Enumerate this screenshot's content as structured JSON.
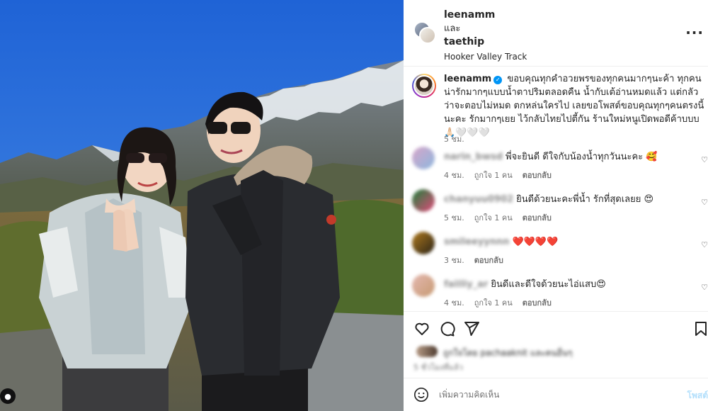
{
  "header": {
    "user1": "leenamm",
    "and_text": "และ",
    "user2": "taethip",
    "location": "Hooker Valley Track",
    "more_icon": "more-horizontal-icon"
  },
  "caption": {
    "username": "leenamm",
    "text": "ขอบคุณทุกคำอวยพรของทุกคนมากๆนะค้า ทุกคนน่ารักมากๆแบบน้ำตาปริมตลอดคืน น้ำกับเต้อ่านหมดแล้ว แต่กลัวว่าจะตอบไม่หมด ตกหล่นใครไป เลยขอโพสต์ขอบคุณทุกๆคนตรงนี้นะคะ รักมากๆเยย ไว้กลับไทยไปตี้กัน ร้านใหม่หนูเปิดพอดีค้าบบบ 🙏🏻🤍🤍🤍",
    "time": "5 ชม."
  },
  "comments": [
    {
      "user": "narin_bwsd",
      "text": "พี่จะยินดี ดีใจกับน้องน้ำทุกวันนะคะ 🥰",
      "time": "4 ชม.",
      "likes": "ถูกใจ 1 คน",
      "reply": "ตอบกลับ"
    },
    {
      "user": "chanyuu0902",
      "text": "ยินดีด้วยนะคะพี่น้ำ รักที่สุดเลยย 😍",
      "time": "5 ชม.",
      "likes": "ถูกใจ 1 คน",
      "reply": "ตอบกลับ"
    },
    {
      "user": "smileeyynnn",
      "text": "❤️❤️❤️❤️",
      "time": "3 ชม.",
      "likes": "",
      "reply": "ตอบกลับ"
    },
    {
      "user": "faiiliy_ar",
      "text": "ยินดีและดีใจด้วยนะไอ่แสบ😍",
      "time": "4 ชม.",
      "likes": "ถูกใจ 1 คน",
      "reply": "ตอบกลับ"
    }
  ],
  "actions": {
    "like_icon": "heart-icon",
    "comment_icon": "comment-icon",
    "share_icon": "share-icon",
    "save_icon": "bookmark-icon"
  },
  "likes_line": "ถูกใจโดย pachaaknit และคนอื่นๆ",
  "post_date": "5 ชั่วโมงที่แล้ว",
  "add_comment": {
    "placeholder": "เพิ่มความคิดเห็น",
    "post_label": "โพสต์",
    "emoji_icon": "emoji-icon"
  },
  "colors": {
    "link_blue": "#0095f6",
    "post_disabled": "#b2dffc",
    "heart_red": "#ed4956"
  }
}
